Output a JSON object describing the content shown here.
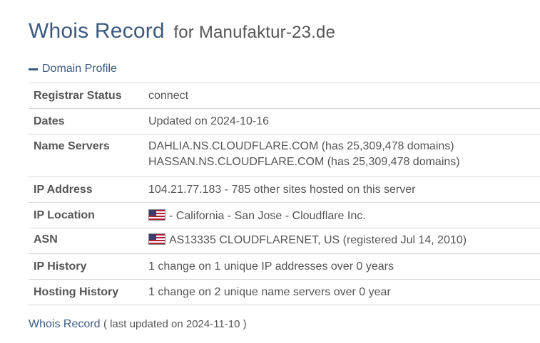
{
  "header": {
    "title": "Whois Record",
    "for_text": "for Manufaktur-23.de"
  },
  "section": {
    "title": "Domain Profile"
  },
  "rows": {
    "registrar_status": {
      "label": "Registrar Status",
      "value": "connect"
    },
    "dates": {
      "label": "Dates",
      "value": "Updated on 2024-10-16"
    },
    "name_servers": {
      "label": "Name Servers",
      "line1": "DAHLIA.NS.CLOUDFLARE.COM (has 25,309,478 domains)",
      "line2": "HASSAN.NS.CLOUDFLARE.COM (has 25,309,478 domains)"
    },
    "ip_address": {
      "label": "IP Address",
      "value": "104.21.77.183 - 785 other sites hosted on this server"
    },
    "ip_location": {
      "label": "IP Location",
      "value": "- California - San Jose - Cloudflare Inc.",
      "flag_icon": "us-flag-icon"
    },
    "asn": {
      "label": "ASN",
      "value": "AS13335 CLOUDFLARENET, US (registered Jul 14, 2010)",
      "flag_icon": "us-flag-icon"
    },
    "ip_history": {
      "label": "IP History",
      "value": "1 change on 1 unique IP addresses over 0 years"
    },
    "hosting_history": {
      "label": "Hosting History",
      "value": "1 change on 2 unique name servers over 0 year"
    }
  },
  "footer": {
    "link": "Whois Record",
    "updated": "( last updated on 2024-11-10 )"
  },
  "colors": {
    "accent": "#3c5a80",
    "text": "#555555",
    "border": "#d9d9d9"
  }
}
